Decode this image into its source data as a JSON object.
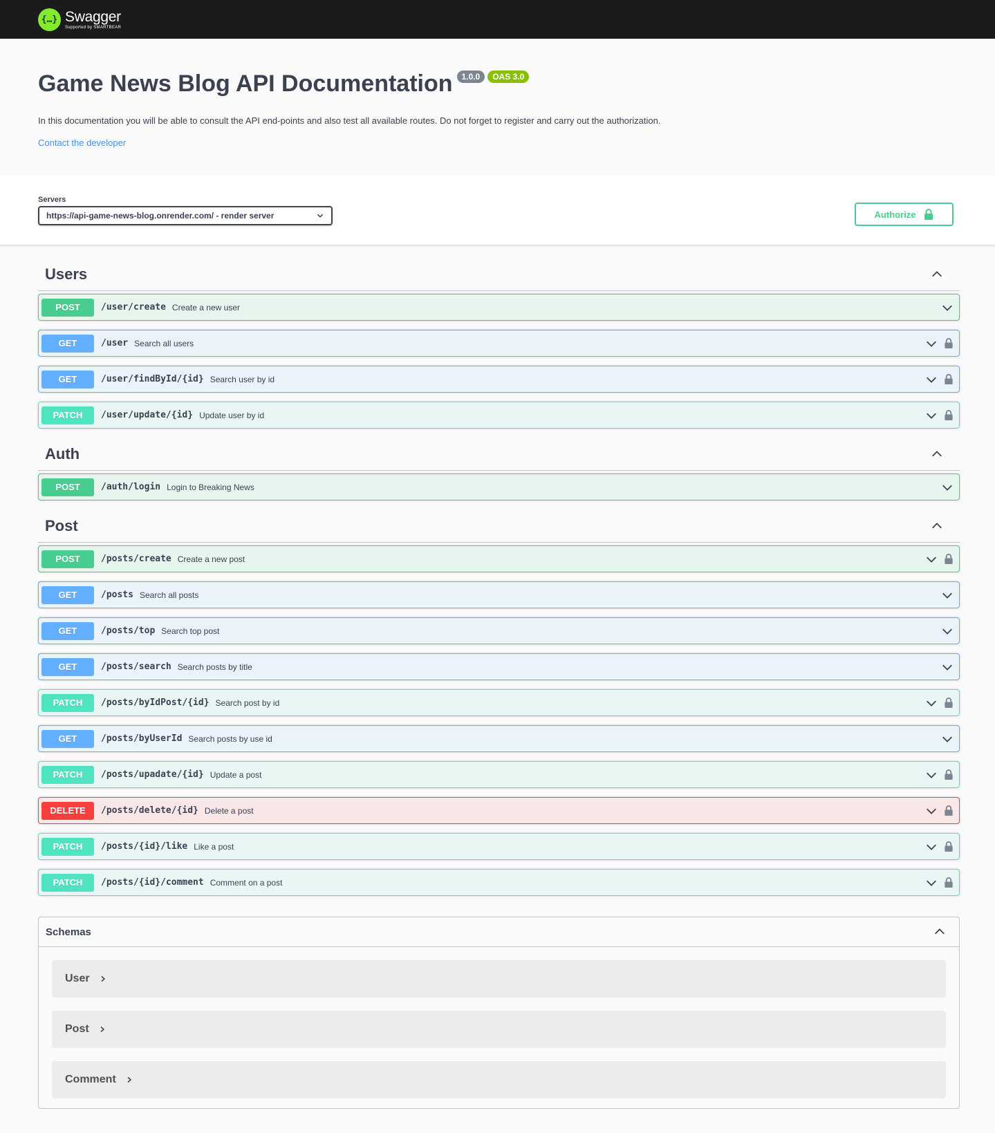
{
  "topbar": {
    "logo_glyph": "{…}",
    "brand": "Swagger",
    "brand_sub": "Supported by SMARTBEAR"
  },
  "info": {
    "title": "Game News Blog API Documentation",
    "version_badge": "1.0.0",
    "oas_badge": "OAS 3.0",
    "description": "In this documentation you will be able to consult the API end-points and also test all available routes. Do not forget to register and carry out the authorization.",
    "contact_link": "Contact the developer"
  },
  "servers": {
    "label": "Servers",
    "selected": "https://api-game-news-blog.onrender.com/ - render server"
  },
  "authorize": {
    "label": "Authorize"
  },
  "sections": [
    {
      "name": "Users",
      "operations": [
        {
          "method": "POST",
          "path": "/user/create",
          "summary": "Create a new user",
          "locked": false
        },
        {
          "method": "GET",
          "path": "/user",
          "summary": "Search all users",
          "locked": true
        },
        {
          "method": "GET",
          "path": "/user/findById/{id}",
          "summary": "Search user by id",
          "locked": true
        },
        {
          "method": "PATCH",
          "path": "/user/update/{id}",
          "summary": "Update user by id",
          "locked": true
        }
      ]
    },
    {
      "name": "Auth",
      "operations": [
        {
          "method": "POST",
          "path": "/auth/login",
          "summary": "Login to Breaking News",
          "locked": false
        }
      ]
    },
    {
      "name": "Post",
      "operations": [
        {
          "method": "POST",
          "path": "/posts/create",
          "summary": "Create a new post",
          "locked": true
        },
        {
          "method": "GET",
          "path": "/posts",
          "summary": "Search all posts",
          "locked": false
        },
        {
          "method": "GET",
          "path": "/posts/top",
          "summary": "Search top post",
          "locked": false
        },
        {
          "method": "GET",
          "path": "/posts/search",
          "summary": "Search posts by title",
          "locked": false
        },
        {
          "method": "PATCH",
          "path": "/posts/byIdPost/{id}",
          "summary": "Search post by id",
          "locked": true
        },
        {
          "method": "GET",
          "path": "/posts/byUserId",
          "summary": "Search posts by use id",
          "locked": false
        },
        {
          "method": "PATCH",
          "path": "/posts/upadate/{id}",
          "summary": "Update a post",
          "locked": true
        },
        {
          "method": "DELETE",
          "path": "/posts/delete/{id}",
          "summary": "Delete a post",
          "locked": true
        },
        {
          "method": "PATCH",
          "path": "/posts/{id}/like",
          "summary": "Like a post",
          "locked": true
        },
        {
          "method": "PATCH",
          "path": "/posts/{id}/comment",
          "summary": "Comment on a post",
          "locked": true
        }
      ]
    }
  ],
  "schemas": {
    "title": "Schemas",
    "models": [
      "User",
      "Post",
      "Comment"
    ]
  },
  "colors": {
    "post": "#49cc90",
    "get": "#61affe",
    "patch": "#50e3c2",
    "delete": "#f93e3e",
    "topbar": "#1b1b1b",
    "logo": "#85ea2d"
  }
}
